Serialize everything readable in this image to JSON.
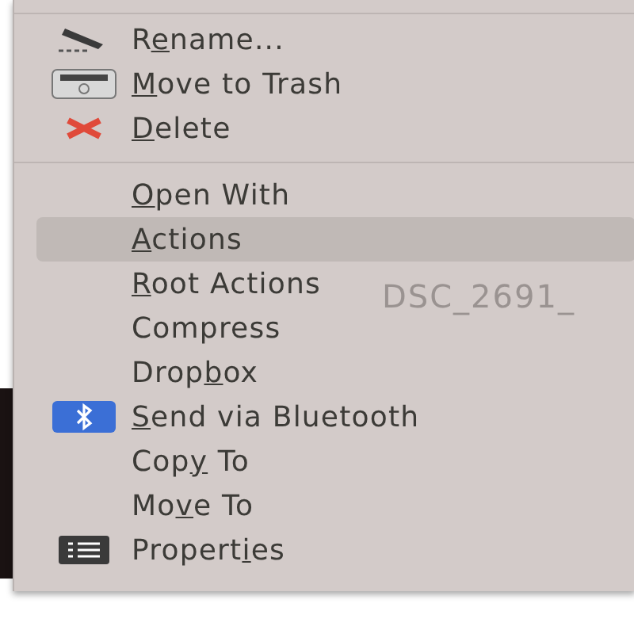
{
  "background_label": "DSC_2691_",
  "menu": {
    "items": [
      {
        "kind": "item",
        "selected": false,
        "label": {
          "pre": "R",
          "key": "e",
          "post": "name..."
        }
      },
      {
        "kind": "item",
        "selected": false,
        "label": {
          "key": "M",
          "post": "ove to Trash"
        }
      },
      {
        "kind": "item",
        "selected": false,
        "label": {
          "key": "D",
          "post": "elete"
        }
      },
      {
        "kind": "separator"
      },
      {
        "kind": "item",
        "selected": false,
        "label": {
          "key": "O",
          "post": "pen With"
        }
      },
      {
        "kind": "item",
        "selected": true,
        "label": {
          "key": "A",
          "post": "ctions"
        }
      },
      {
        "kind": "item",
        "selected": false,
        "label": {
          "key": "R",
          "post": "oot Actions"
        }
      },
      {
        "kind": "item",
        "selected": false,
        "label": {
          "pre": "Compress"
        }
      },
      {
        "kind": "item",
        "selected": false,
        "label": {
          "pre": "Drop",
          "key": "b",
          "post": "ox"
        }
      },
      {
        "kind": "item",
        "selected": false,
        "label": {
          "key": "S",
          "post": "end via Bluetooth"
        }
      },
      {
        "kind": "item",
        "selected": false,
        "label": {
          "pre": "Cop",
          "key": "y",
          "post": " To"
        }
      },
      {
        "kind": "item",
        "selected": false,
        "label": {
          "pre": "Mo",
          "key": "v",
          "post": "e To"
        }
      },
      {
        "kind": "item",
        "selected": false,
        "label": {
          "pre": "Propert",
          "key": "i",
          "post": "es"
        }
      }
    ]
  }
}
